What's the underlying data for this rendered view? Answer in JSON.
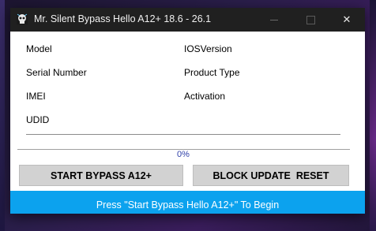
{
  "window": {
    "title": "Mr. Silent Bypass Hello A12+ 18.6 - 26.1",
    "minimize_glyph": "",
    "maximize_glyph": "",
    "close_glyph": "✕"
  },
  "device_info": {
    "model_label": "Model",
    "serial_label": "Serial Number",
    "imei_label": "IMEI",
    "udid_label": "UDID",
    "ios_label": "IOSVersion",
    "product_type_label": "Product Type",
    "activation_label": "Activation"
  },
  "progress": {
    "text": "0%",
    "value": 0
  },
  "buttons": {
    "start_label": "START BYPASS A12+",
    "block_label": "BLOCK UPDATE  RESET"
  },
  "status": {
    "text": "Press \"Start Bypass Hello A12+\" To Begin"
  },
  "colors": {
    "titlebar": "#202020",
    "statusbar": "#0ca2ee",
    "button": "#d2d2d2",
    "progress_text": "#2e3fa8"
  },
  "icons": {
    "app": "skull-icon"
  }
}
